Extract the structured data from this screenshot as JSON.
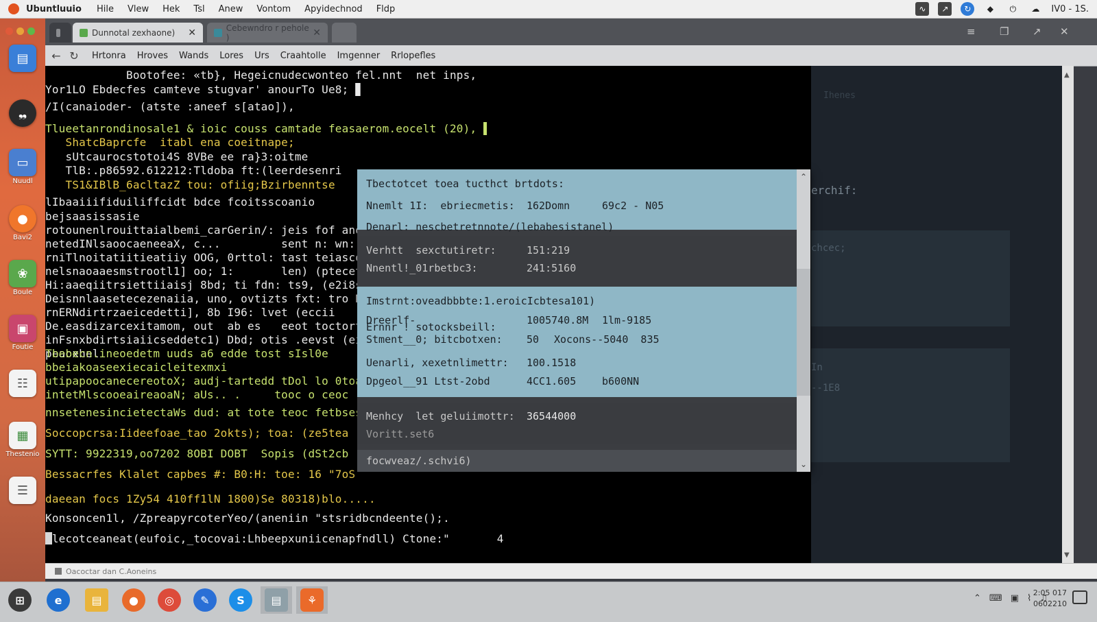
{
  "menubar": {
    "app_name": "Ubuntluuio",
    "items": [
      "Hile",
      "Vlew",
      "Hek",
      "Tsl",
      "Anew",
      "Vontom",
      "Apyidechnod",
      "Fldp"
    ],
    "clock": "IV0 - 1S.",
    "tray_icons": [
      "activity-icon",
      "chart-icon",
      "update-icon",
      "location-icon",
      "power-icon",
      "cloud-icon"
    ]
  },
  "launcher": {
    "items": [
      {
        "icon": "files-icon",
        "label": "",
        "color": "#3a7fd8"
      },
      {
        "icon": "terminal-icon",
        "label": "",
        "color": "#2a2a2a"
      },
      {
        "icon": "nautilus-icon",
        "label": "Nuudl",
        "color": "#4a7fd0"
      },
      {
        "icon": "firefox-icon",
        "label": "Bavi2",
        "color": "#f0762b"
      },
      {
        "icon": "photos-icon",
        "label": "Boule",
        "color": "#5aa84c"
      },
      {
        "icon": "software-icon",
        "label": "Foutie",
        "color": "#c9466d"
      },
      {
        "icon": "calculator-icon",
        "label": "",
        "color": "#f3f3f3"
      },
      {
        "icon": "spreadsheet-icon",
        "label": "Thestenio",
        "color": "#f3f3f3"
      },
      {
        "icon": "document-icon",
        "label": "",
        "color": "#f3f3f3"
      }
    ]
  },
  "window": {
    "tabs": [
      {
        "label": "Dunnotal zexhaone)",
        "active": true
      },
      {
        "label": "Cebewndro r pehole )",
        "active": false
      }
    ],
    "toolbar": [
      "Hrtonra",
      "Hroves",
      "Wands",
      "Lores",
      "Urs",
      "Craahtolle",
      "Imgenner",
      "Rrlopefles"
    ]
  },
  "terminal": {
    "lines": [
      {
        "text": "            Bootofee: «tb}, Hegeicnudecwonteo fel.nnt  net inps,",
        "color": "w"
      },
      {
        "text": "Yor1LO Ebdecfes camteve stugvar' anourTo Ue8; ▊",
        "color": "w"
      },
      {
        "text": "/I(canaioder- (atste :aneef s[atao]),",
        "color": "w"
      },
      {
        "text": "Tlueetanrondinosale1 & ioic couss camtade feasaerom.eocelt (20), ▌",
        "color": "g"
      },
      {
        "text": "   ShatcBaprcfe  itabl ena coeitnape;",
        "color": "y"
      },
      {
        "text": "   sUtcaurocstotoi4S 8VBe ee ra}3:oitme",
        "color": "w"
      },
      {
        "text": "   TlB:.p86592.612212:Tldoba ft:(leerdesenri",
        "color": "w"
      },
      {
        "text": "   TS1&IBlB_6acltazZ tou: ofiig;Bzirbenntse",
        "color": "y"
      },
      {
        "text": "lIbaaiiifiduiliffcidt bdce fcoitsscoanio",
        "color": "w"
      },
      {
        "text": "bejsaasissasie",
        "color": "w"
      },
      {
        "text": "rotounenlrouittaialbemi_carGerin/: jeis fof anou",
        "color": "w"
      },
      {
        "text": "netedINlsaoocaeneeaX, c...         sent n: wn:r",
        "color": "w"
      },
      {
        "text": "rniTlnoitatiitieatiiy OOG, 0rttol: tast teiasco",
        "color": "w"
      },
      {
        "text": "nelsnaoaaesmstrootl1] oo; 1:       len) (ptecet",
        "color": "w"
      },
      {
        "text": "Hi:aaeqiitrsiettiiaisj 8bd; ti fdn: ts9, (e2i8s",
        "color": "w"
      },
      {
        "text": "Deisnnlaasetecezenaiia, uno, ovtizts fxt: tro N:",
        "color": "w"
      },
      {
        "text": "rnERNdirtrzaeicedetti], 8b I96: lvet (eccii",
        "color": "w"
      },
      {
        "text": "De.easdizarcexitamom, out  ab es   eeot toctort",
        "color": "w"
      },
      {
        "text": "inFsnxbdirtsiaiicseddetc1) Dbd; otis .eevst (einc",
        "color": "w"
      },
      {
        "text": "peaoxhel",
        "color": "w"
      },
      {
        "text": "Tbebecn.ineoedetm uuds a6 edde tost sIsl0e",
        "color": "g"
      },
      {
        "text": "bbeiakoaseexiecaicleitexmxi",
        "color": "g"
      },
      {
        "text": "utipapoocanecereotoX; audj-tartedd tDol lo 0toa",
        "color": "g"
      },
      {
        "text": "intetMlscooeaireaoaN; aUs.. .     tooc o ceoc",
        "color": "g"
      },
      {
        "text": "nnsetenesincietectaWs dud: at tote teoc fetbses:",
        "color": "g"
      },
      {
        "text": "Soccopcrsa:Iideefoae_tao 2okts); toa: (ze5tea",
        "color": "y"
      },
      {
        "text": "SYTT: 9922319,oo7202 8OBI DOBT  Sopis (dSt2cb",
        "color": "g"
      },
      {
        "text": "Bessacrfes Klalet capbes #: B0:H: toe: 16 \"7oS",
        "color": "y"
      },
      {
        "text": "daeean focs 1Zy54 410ff1lN 1800)Se 80318)blo.....",
        "color": "y"
      },
      {
        "text": "Konsoncen1l, /ZpreapyrcoterYeo/(aneniin \"stsridbcndeente();.",
        "color": "w"
      },
      {
        "text": "Hlecotceaneat(eufoic,_tocovai:Lhbeepxuniicenapfndll) Ctone:\"       4",
        "color": "w"
      }
    ]
  },
  "popup": {
    "title": "Tbectotcet toea tucthct brtdots:",
    "section1": [
      {
        "label": "Nnemlt 1I:  ebriecmetis:",
        "value": "162Domn",
        "extra": "69c2 - N05"
      },
      {
        "label": "Denarl: nescbetretnnote/(lebabesistanel)",
        "value": "",
        "extra": ""
      }
    ],
    "section2": [
      {
        "label": "Verhtt  sexctutiretr:",
        "value": "151:219",
        "extra": ""
      },
      {
        "label": "Nnentl!_01rbetbc3:",
        "value": "241:5160",
        "extra": ""
      }
    ],
    "section3_title": "Imstrnt:oveadbbbte:1.eroicIcbtesa101)",
    "section3": [
      {
        "label": "Dreerlf-",
        "value": "",
        "extra": ""
      },
      {
        "label": "Ernnr ! sotocksbeill:",
        "value": "1005740.8M",
        "extra": "1lm-9185"
      },
      {
        "label": "Stment__0; bitcbotxen:",
        "value": "50",
        "extra": "Xocons--5040  835"
      },
      {
        "label": "Uenarli, xexetnlimettr:",
        "value": "100.1518",
        "extra": ""
      },
      {
        "label": "Dpgeol__91 Ltst-2obd",
        "value": "4CC1.605",
        "extra": "b600NN"
      }
    ],
    "section4": [
      {
        "label": "Menhcy  let geluiimottr:",
        "value": "36544000",
        "extra": ""
      },
      {
        "label": "Voritt.set6",
        "value": "",
        "extra": ""
      }
    ],
    "footer": "focwveaz/.schvi6)"
  },
  "right_panel": {
    "label1": "Ihenes",
    "label2": "erchif:",
    "label3": "chcec;",
    "label4": "In",
    "label5": "--1E8"
  },
  "statusbar": {
    "text": "Oacoctar dan C.Aoneins"
  },
  "taskbar": {
    "items": [
      {
        "icon": "start-icon",
        "color": "#3a3a3a"
      },
      {
        "icon": "edge-icon",
        "color": "#1f6fd0"
      },
      {
        "icon": "folder-icon",
        "color": "#e9b43c"
      },
      {
        "icon": "firefox-icon",
        "color": "#e86a2a"
      },
      {
        "icon": "chrome-icon",
        "color": "#dd4b3a"
      },
      {
        "icon": "pencil-icon",
        "color": "#2a6fd6"
      },
      {
        "icon": "skype-icon",
        "color": "#1c8ee8"
      },
      {
        "icon": "folder-alt-icon",
        "color": "#8fa0a8"
      },
      {
        "icon": "app-icon",
        "color": "#ea6a2a"
      }
    ],
    "clock_time": "2:05 017",
    "clock_date": "0602210"
  }
}
